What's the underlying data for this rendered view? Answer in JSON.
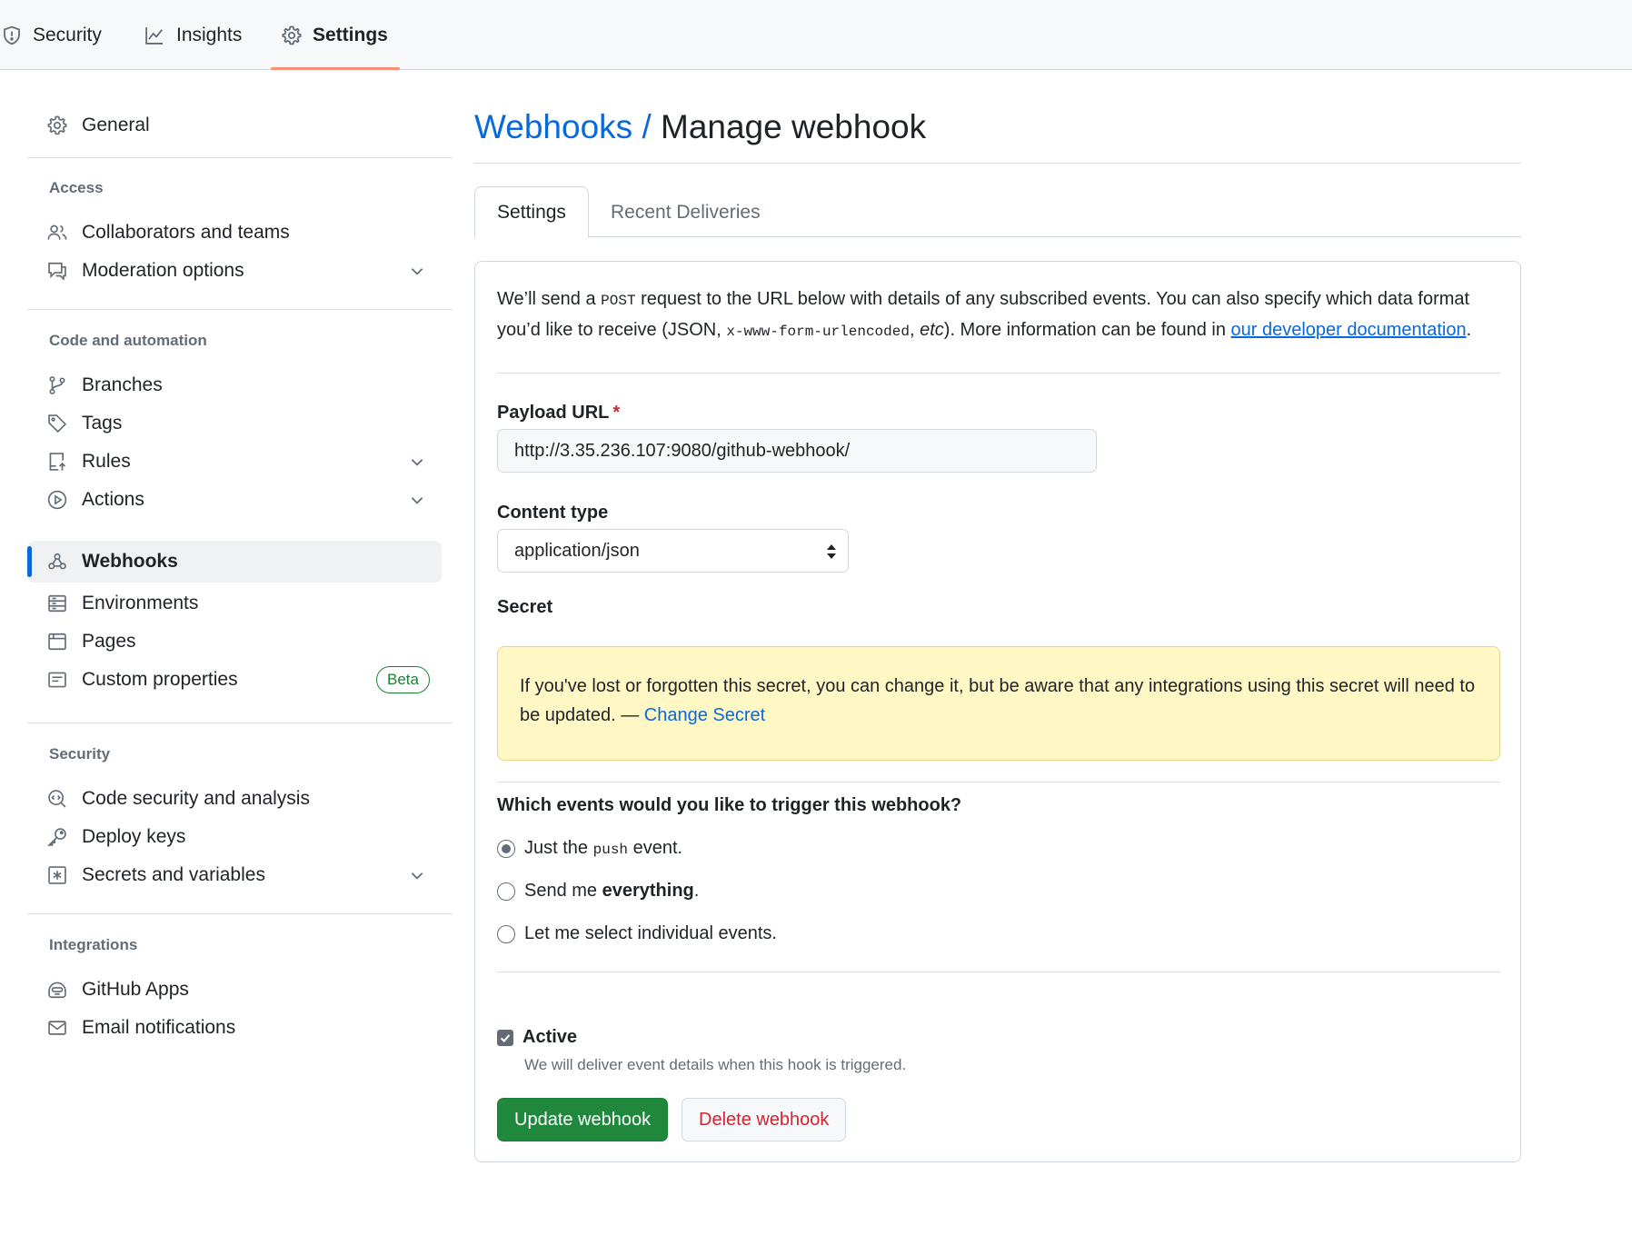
{
  "topnav": {
    "tabs": [
      {
        "label": "Security",
        "icon": "shield-icon"
      },
      {
        "label": "Insights",
        "icon": "graph-icon"
      },
      {
        "label": "Settings",
        "icon": "gear-icon",
        "selected": true
      }
    ]
  },
  "sidebar": {
    "general": "General",
    "sections": {
      "access": "Access",
      "code_automation": "Code and automation",
      "security": "Security",
      "integrations": "Integrations"
    },
    "items": {
      "collaborators": "Collaborators and teams",
      "moderation": "Moderation options",
      "branches": "Branches",
      "tags": "Tags",
      "rules": "Rules",
      "actions": "Actions",
      "webhooks": "Webhooks",
      "environments": "Environments",
      "pages": "Pages",
      "custom_properties": "Custom properties",
      "custom_properties_badge": "Beta",
      "code_security": "Code security and analysis",
      "deploy_keys": "Deploy keys",
      "secrets": "Secrets and variables",
      "github_apps": "GitHub Apps",
      "email_notifications": "Email notifications"
    },
    "active": "Webhooks"
  },
  "main": {
    "breadcrumb": "Webhooks",
    "separator": "/",
    "title": "Manage webhook",
    "tabs": {
      "settings": "Settings",
      "recent_deliveries": "Recent Deliveries"
    },
    "description": {
      "part1": "We’ll send a ",
      "post_code": "POST",
      "part2": " request to the URL below with details of any subscribed events. You can also specify which data format you’d like to receive (JSON, ",
      "form_code": "x-www-form-urlencoded",
      "part3": ", ",
      "etc": "etc",
      "part4": "). More information can be found in ",
      "link": "our developer documentation",
      "part5": "."
    },
    "payload_url": {
      "label": "Payload URL",
      "required_mark": "*",
      "value": "http://3.35.236.107:9080/github-webhook/"
    },
    "content_type": {
      "label": "Content type",
      "selected": "application/json"
    },
    "secret": {
      "label": "Secret",
      "notice": "If you've lost or forgotten this secret, you can change it, but be aware that any integrations using this secret will need to be updated. — ",
      "change_link": "Change Secret"
    },
    "events": {
      "question": "Which events would you like to trigger this webhook?",
      "options": {
        "push_pre": "Just the ",
        "push_code": "push",
        "push_post": " event.",
        "everything_pre": "Send me ",
        "everything_bold": "everything",
        "everything_post": ".",
        "individual": "Let me select individual events."
      },
      "selected": "push"
    },
    "active": {
      "label": "Active",
      "checked": true,
      "note": "We will deliver event details when this hook is triggered."
    },
    "buttons": {
      "update": "Update webhook",
      "delete": "Delete webhook"
    }
  },
  "colors": {
    "accent": "#0969da",
    "primary_button": "#1f883d",
    "danger": "#d1242f",
    "tab_underline": "#fd8c73",
    "flash_bg": "#fff8c5"
  }
}
